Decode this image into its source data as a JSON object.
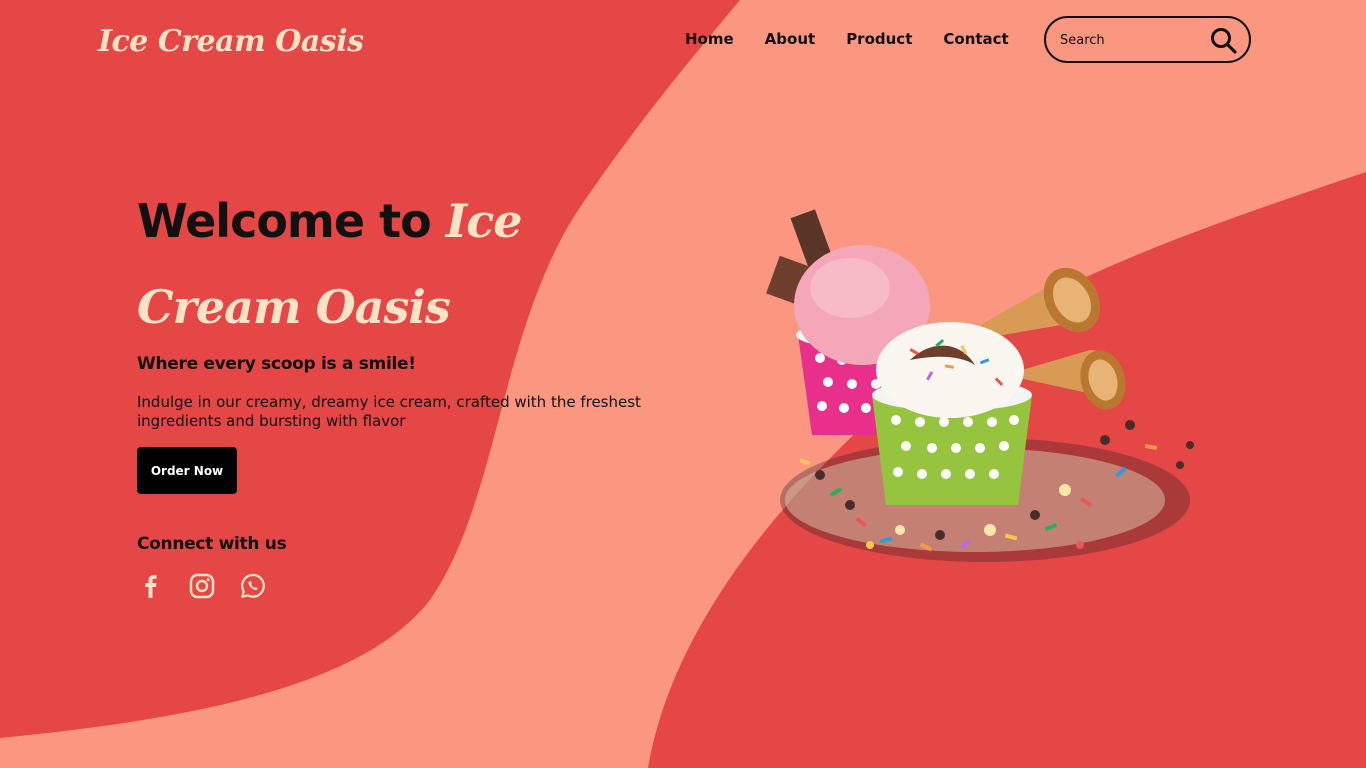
{
  "header": {
    "logo": "Ice Cream Oasis",
    "nav": [
      "Home",
      "About",
      "Product",
      "Contact"
    ],
    "search_placeholder": "Search"
  },
  "hero": {
    "title_prefix": "Welcome to ",
    "title_brand": "Ice Cream Oasis",
    "tagline": "Where every scoop is a smile!",
    "description": "Indulge in our creamy, dreamy ice cream, crafted with the freshest ingredients and bursting with flavor",
    "cta_label": "Order Now",
    "connect_heading": "Connect with us"
  },
  "socials": [
    "facebook-icon",
    "instagram-icon",
    "whatsapp-icon"
  ],
  "colors": {
    "background": "#e54646",
    "wave": "#fb9781",
    "accent_text": "#ffe3c4",
    "text": "#111111",
    "button": "#000000"
  }
}
